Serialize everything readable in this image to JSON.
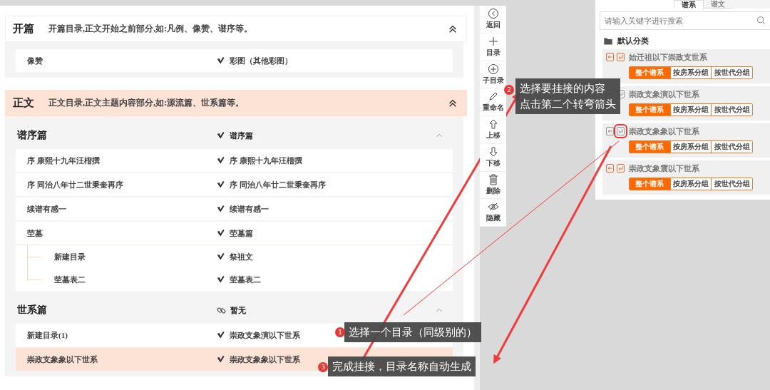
{
  "sections": [
    {
      "title": "开篇",
      "description": "开篇目录,正文开始之前部分,如:凡例、像赞、谱序等。",
      "highlighted": false,
      "expanded": true,
      "groups": [
        {
          "rows": [
            {
              "name": "像赞",
              "link": "彩图（其他彩图）",
              "kind": "tick",
              "selected": false
            }
          ]
        }
      ]
    },
    {
      "title": "正文",
      "description": "正文目录,正文主题内容部分,如:源流篇、世系篇等。",
      "highlighted": true,
      "expanded": true,
      "groups": [
        {
          "title": "谱序篇",
          "link": "谱序篇",
          "kind": "tick",
          "expanded": true,
          "rows": [
            {
              "name": "序 康熙十九年汪榗撰",
              "link": "序 康熙十九年汪榗撰",
              "kind": "tick",
              "selected": false
            },
            {
              "name": "序 同治八年廿二世秉奎再序",
              "link": "序 同治八年廿二世秉奎再序",
              "kind": "tick",
              "selected": false
            },
            {
              "name": "续谱有感一",
              "link": "续谱有感一",
              "kind": "tick",
              "selected": false
            },
            {
              "name": "茔墓",
              "link": "茔墓篇",
              "kind": "tick",
              "selected": false,
              "children": [
                {
                  "name": "新建目录",
                  "link": "祭祖文",
                  "kind": "tick",
                  "selected": false
                },
                {
                  "name": "茔墓表二",
                  "link": "茔墓表二",
                  "kind": "tick",
                  "selected": false
                }
              ]
            }
          ]
        },
        {
          "title": "世系篇",
          "link": "暂无",
          "kind": "chain",
          "expanded": true,
          "rows": [
            {
              "name": "新建目录(1)",
              "link": "崇政支象演以下世系",
              "kind": "tick",
              "selected": false
            },
            {
              "name": "崇政支象象以下世系",
              "link": "崇政支象象以下世系",
              "kind": "tick",
              "selected": true
            }
          ]
        }
      ]
    }
  ],
  "toolbar": [
    {
      "kind": "back",
      "label": "返回"
    },
    {
      "kind": "plus",
      "label": "目录"
    },
    {
      "kind": "circle-plus",
      "label": "子目录"
    },
    {
      "kind": "pencil",
      "label": "重命名"
    },
    {
      "kind": "up",
      "label": "上移"
    },
    {
      "kind": "down",
      "label": "下移"
    },
    {
      "kind": "trash",
      "label": "删除"
    },
    {
      "kind": "eye",
      "label": "隐藏"
    }
  ],
  "side_panel": {
    "tabs": [
      {
        "label": "谱系",
        "selected": true
      },
      {
        "label": "谱文",
        "selected": false
      }
    ],
    "search": {
      "placeholder": "请输入关键字进行搜索"
    },
    "category": "默认分类",
    "cards": [
      {
        "title": "始迁祖以下崇政支世系",
        "active": true,
        "marked": false,
        "modes": [
          {
            "label": "整个谱系",
            "selected": true
          },
          {
            "label": "按房系分组",
            "selected": false
          },
          {
            "label": "按世代分组",
            "selected": false
          }
        ]
      },
      {
        "title": "崇政支象演以下世系",
        "active": false,
        "marked": false,
        "modes": [
          {
            "label": "整个谱系",
            "selected": true
          },
          {
            "label": "按房系分组",
            "selected": false
          },
          {
            "label": "按世代分组",
            "selected": false
          }
        ]
      },
      {
        "title": "崇政支象象以下世系",
        "active": false,
        "marked": true,
        "modes": [
          {
            "label": "整个谱系",
            "selected": true
          },
          {
            "label": "按房系分组",
            "selected": false
          },
          {
            "label": "按世代分组",
            "selected": false
          }
        ]
      },
      {
        "title": "崇政支象震以下世系",
        "active": true,
        "marked": false,
        "modes": [
          {
            "label": "整个谱系",
            "selected": true
          },
          {
            "label": "按房系分组",
            "selected": false
          },
          {
            "label": "按世代分组",
            "selected": false
          }
        ]
      }
    ]
  },
  "callouts": [
    {
      "number": "1",
      "lines": [
        "选择一个目录（同级别的）"
      ]
    },
    {
      "number": "2",
      "lines": [
        "选择要挂接的内容",
        "点击第二个转弯箭头"
      ]
    },
    {
      "number": "3",
      "lines": [
        "完成挂接，目录名称自动生成"
      ]
    }
  ]
}
